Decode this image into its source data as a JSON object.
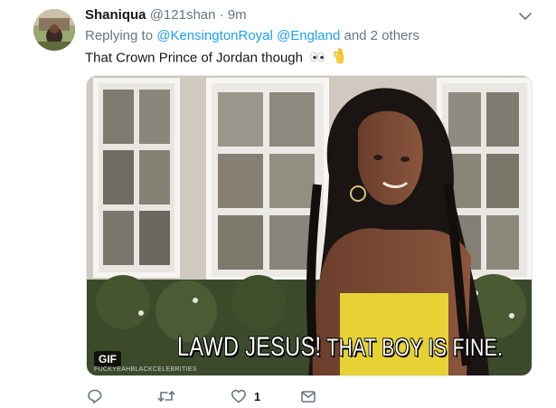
{
  "tweet": {
    "name": "Shaniqua",
    "handle": "@121shan",
    "separator": "·",
    "time": "9m",
    "replying_prefix": "Replying to",
    "mentions": [
      "@KensingtonRoyal",
      "@England"
    ],
    "replying_suffix": "and 2 others",
    "text": "That Crown Prince of Jordan though",
    "emojis": [
      "eyes-emoji",
      "ok-hand-emoji"
    ]
  },
  "media": {
    "badge": "GIF",
    "caption_part1": "LAWD JESUS!",
    "caption_part2": "THAT BOY IS FINE.",
    "watermark": "FUCKYEAHBLACKCELEBRITIES"
  },
  "actions": {
    "reply_icon": "reply-icon",
    "retweet_icon": "retweet-icon",
    "like_icon": "heart-icon",
    "like_count": "1",
    "dm_icon": "envelope-icon"
  },
  "colors": {
    "link": "#1da1f2",
    "secondary_text": "#657786",
    "primary_text": "#14171a"
  }
}
